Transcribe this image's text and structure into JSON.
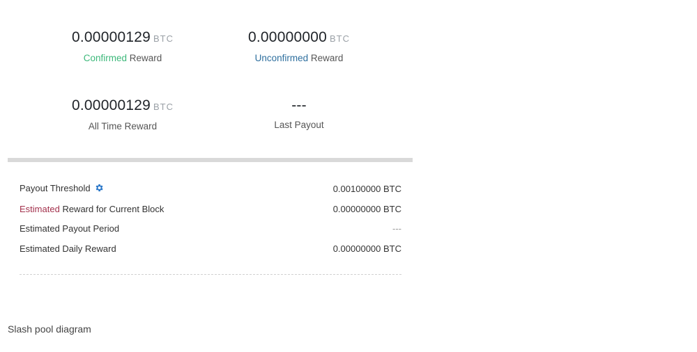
{
  "stats": {
    "confirmed": {
      "value": "0.00000129",
      "unit": "BTC",
      "label_colored": "Confirmed",
      "label_rest": "Reward"
    },
    "unconfirmed": {
      "value": "0.00000000",
      "unit": "BTC",
      "label_colored": "Unconfirmed",
      "label_rest": "Reward"
    },
    "all_time": {
      "value": "0.00000129",
      "unit": "BTC",
      "label": "All Time Reward"
    },
    "last_payout": {
      "value": "---",
      "label": "Last Payout"
    }
  },
  "details": {
    "payout_threshold_label": "Payout Threshold",
    "payout_threshold_value": "0.00100000 BTC",
    "estimated_reward_colored": "Estimated",
    "estimated_reward_rest": "Reward for Current Block",
    "estimated_reward_value": "0.00000000 BTC",
    "payout_period_label": "Estimated Payout Period",
    "payout_period_value": "---",
    "daily_reward_label": "Estimated Daily Reward",
    "daily_reward_value": "0.00000000 BTC"
  },
  "footer": {
    "text": "Slash pool diagram"
  },
  "colors": {
    "confirmed": "#3cb87a",
    "unconfirmed": "#2e6f9e",
    "estimated": "#a3324d",
    "gear": "#2a77c9"
  },
  "icons": {
    "threshold_settings": "gear-icon"
  }
}
